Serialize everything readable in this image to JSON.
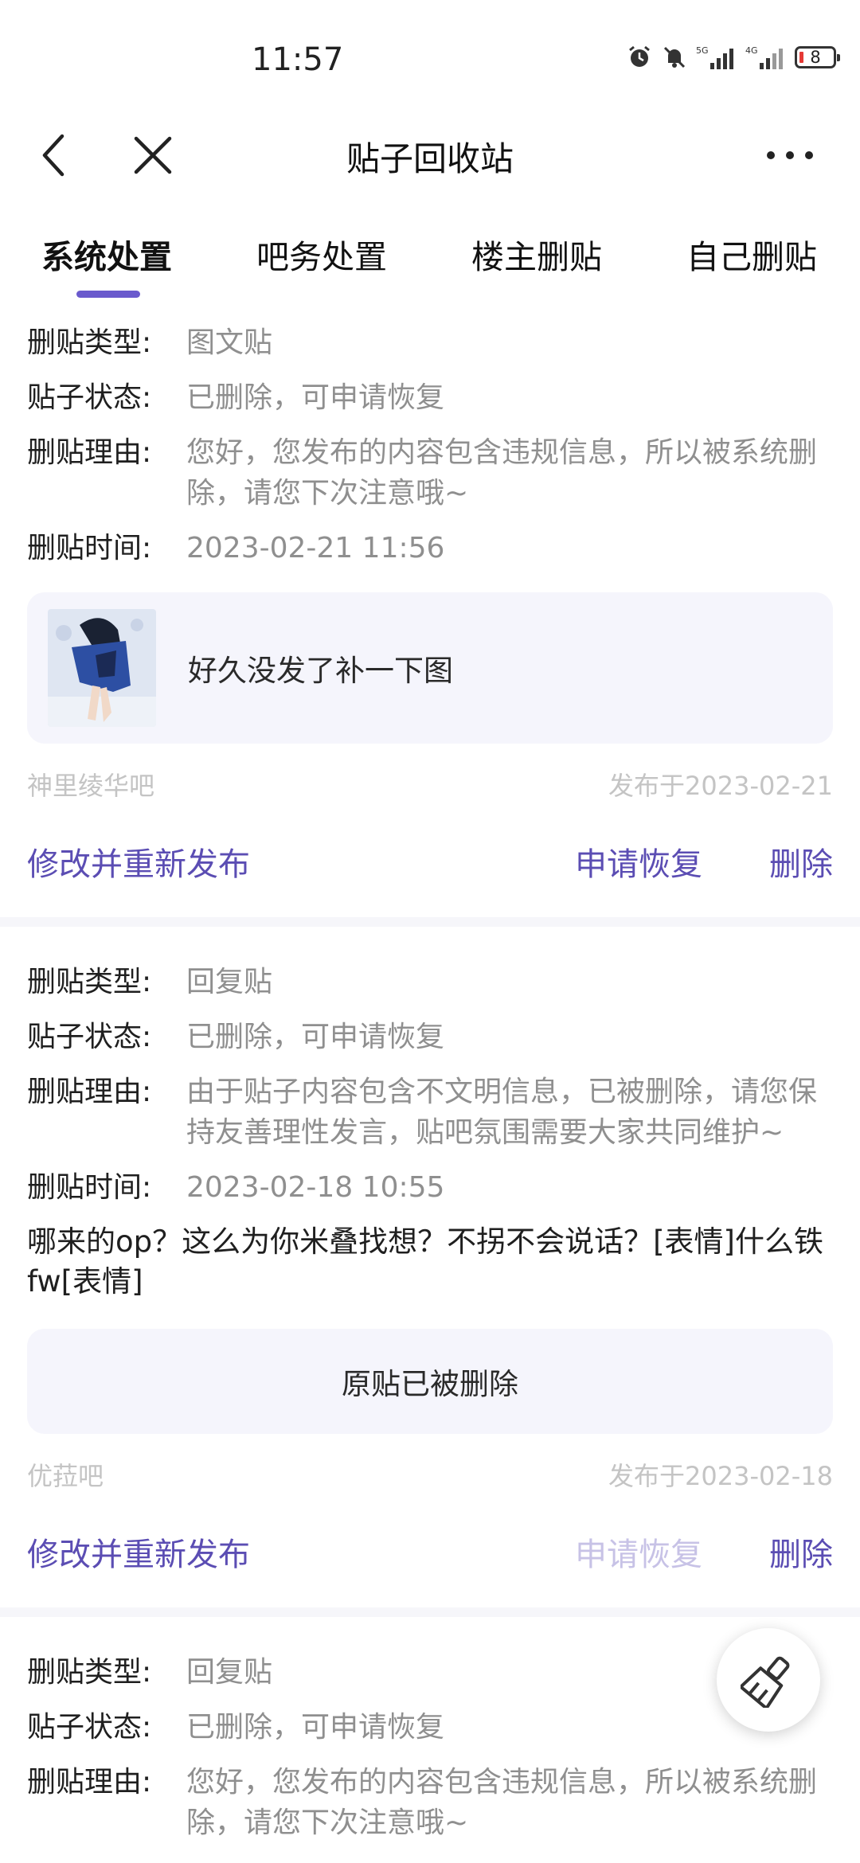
{
  "status_bar": {
    "time": "11:57",
    "network_5g": "5G",
    "network_4g": "4G",
    "battery": "8",
    "icons": [
      "alarm-icon",
      "mute-icon",
      "signal-5g-icon",
      "signal-4g-icon",
      "battery-icon"
    ]
  },
  "nav": {
    "title": "贴子回收站",
    "back_icon": "chevron-left-icon",
    "close_icon": "close-icon",
    "more_icon": "more-dots-icon"
  },
  "tabs": [
    {
      "label": "系统处置",
      "active": true
    },
    {
      "label": "吧务处置"
    },
    {
      "label": "楼主删贴"
    },
    {
      "label": "自己删贴"
    }
  ],
  "labels": {
    "type": "删贴类型:",
    "status": "贴子状态:",
    "reason": "删贴理由:",
    "time": "删贴时间:"
  },
  "posts": [
    {
      "type": "图文贴",
      "status": "已删除，可申请恢复",
      "reason": "您好，您发布的内容包含违规信息，所以被系统删除，请您下次注意哦~",
      "time": "2023-02-21 11:56",
      "preview_title": "好久没发了补一下图",
      "forum": "神里绫华吧",
      "published": "发布于2023-02-21",
      "edit_label": "修改并重新发布",
      "restore_label": "申请恢复",
      "delete_label": "删除"
    },
    {
      "type": "回复贴",
      "status": "已删除，可申请恢复",
      "reason": "由于贴子内容包含不文明信息，已被删除，请您保持友善理性发言，贴吧氛围需要大家共同维护~",
      "time": "2023-02-18 10:55",
      "content": "哪来的op？这么为你米叠找想？不拐不会说话？[表情]什么铁fw[表情]",
      "original_status": "原贴已被删除",
      "forum": "优菈吧",
      "published": "发布于2023-02-18",
      "edit_label": "修改并重新发布",
      "restore_label": "申请恢复",
      "delete_label": "删除"
    },
    {
      "type": "回复贴",
      "status": "已删除，可申请恢复",
      "reason": "您好，您发布的内容包含违规信息，所以被系统删除，请您下次注意哦~"
    }
  ],
  "fab_icon": "broom-icon",
  "colors": {
    "accent": "#5b4db3",
    "indicator": "#6a5acd",
    "muted": "#8f8f8f",
    "card_bg": "#f5f5fc"
  }
}
